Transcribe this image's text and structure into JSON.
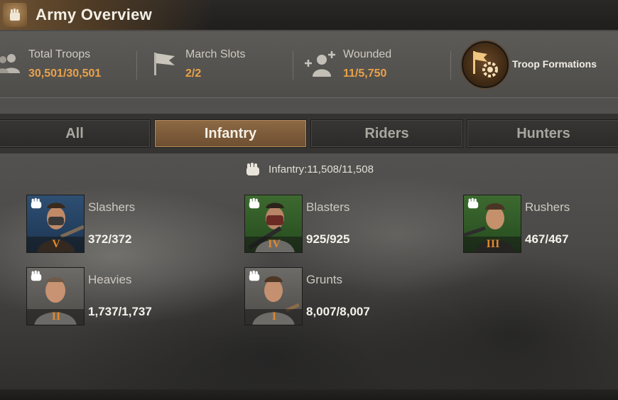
{
  "header": {
    "title": "Army Overview",
    "icon": "barracks-fist-icon"
  },
  "stats": {
    "total_troops": {
      "label": "Total Troops",
      "value": "30,501/30,501",
      "icon": "troops-people-icon"
    },
    "march_slots": {
      "label": "March Slots",
      "value": "2/2",
      "icon": "flag-icon"
    },
    "wounded": {
      "label": "Wounded",
      "value": "11/5,750",
      "icon": "wounded-person-plus-icon"
    },
    "formations": {
      "label": "Troop Formations",
      "icon": "formation-flag-gear-icon"
    }
  },
  "tabs": [
    {
      "label": "All",
      "active": false
    },
    {
      "label": "Infantry",
      "active": true
    },
    {
      "label": "Riders",
      "active": false
    },
    {
      "label": "Hunters",
      "active": false
    }
  ],
  "summary": {
    "text": "Infantry:11,508/11,508",
    "icon": "fist-icon"
  },
  "troops": [
    {
      "name": "Slashers",
      "count": "372/372",
      "tier": "V",
      "bg": "blue"
    },
    {
      "name": "Blasters",
      "count": "925/925",
      "tier": "IV",
      "bg": "green"
    },
    {
      "name": "Rushers",
      "count": "467/467",
      "tier": "III",
      "bg": "green"
    },
    {
      "name": "Heavies",
      "count": "1,737/1,737",
      "tier": "II",
      "bg": "gray"
    },
    {
      "name": "Grunts",
      "count": "8,007/8,007",
      "tier": "I",
      "bg": "gray"
    }
  ],
  "colors": {
    "accent_value": "#e9a24a",
    "tier_numeral": "#e0892e",
    "active_tab": "#8e6a45"
  }
}
